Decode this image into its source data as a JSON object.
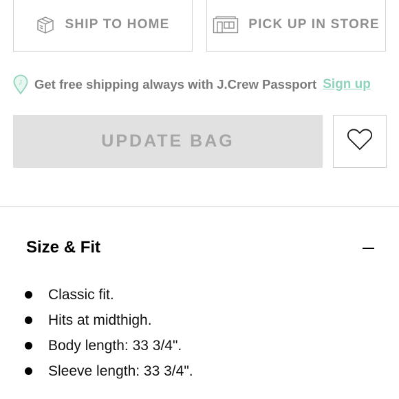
{
  "delivery_options": {
    "ship_to_home": {
      "label": "SHIP TO HOME",
      "icon": "box-icon"
    },
    "pick_up_in_store": {
      "label": "PICK UP IN STORE",
      "icon": "store-icon"
    }
  },
  "promo": {
    "text": "Get free shipping always with J.Crew Passport",
    "link_label": "Sign up",
    "icon": "location-pin-icon",
    "link_color": "#8fd3bb"
  },
  "actions": {
    "update_bag_label": "UPDATE BAG",
    "wishlist_icon": "heart-icon"
  },
  "size_fit": {
    "title": "Size & Fit",
    "toggle_icon": "minus-icon",
    "items": [
      "Classic fit.",
      "Hits at midthigh.",
      "Body length: 33 3/4\".",
      "Sleeve length: 33 3/4\"."
    ]
  }
}
